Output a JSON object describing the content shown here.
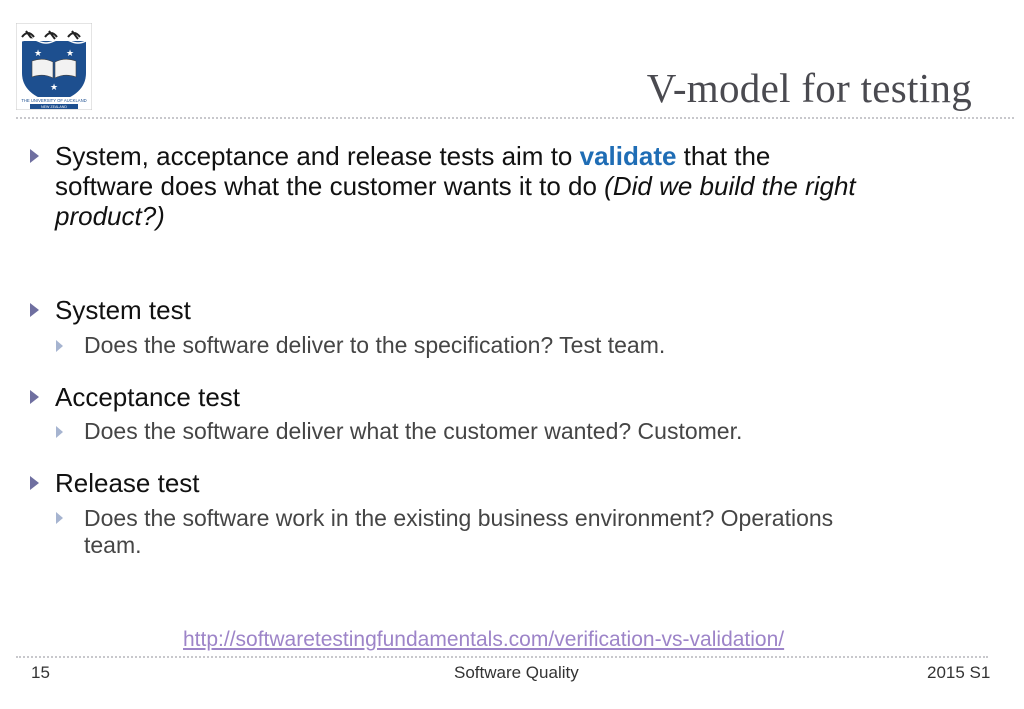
{
  "slide": {
    "title": "V-model for testing",
    "logo": {
      "label": "The University of Auckland New Zealand crest",
      "caption_line1": "THE UNIVERSITY OF AUCKLAND",
      "caption_line2": "NEW ZEALAND"
    },
    "intro": {
      "part1": "System, acceptance and release tests aim to ",
      "highlight": "validate",
      "part2": " that the",
      "line2_plain": "software does what the customer wants it to do ",
      "line2_italic": "(Did we build the right",
      "line3_italic": "product?)"
    },
    "bullets": [
      {
        "heading": "System test",
        "detail": "Does the software deliver to the specification? Test team."
      },
      {
        "heading": "Acceptance test",
        "detail": "Does the software deliver what the customer wanted? Customer."
      },
      {
        "heading": "Release test",
        "detail_line1": "Does the software work in the existing business environment? Operations",
        "detail_line2": "team."
      }
    ],
    "reference_link": "http://softwaretestingfundamentals.com/verification-vs-validation/"
  },
  "footer": {
    "page_number": "15",
    "course": "Software Quality",
    "term": "2015 S1"
  },
  "colors": {
    "accent": "#1f6db5",
    "link": "#9d84c8",
    "bullet": "#6f6fa0",
    "sub_bullet": "#a6b4d0"
  }
}
